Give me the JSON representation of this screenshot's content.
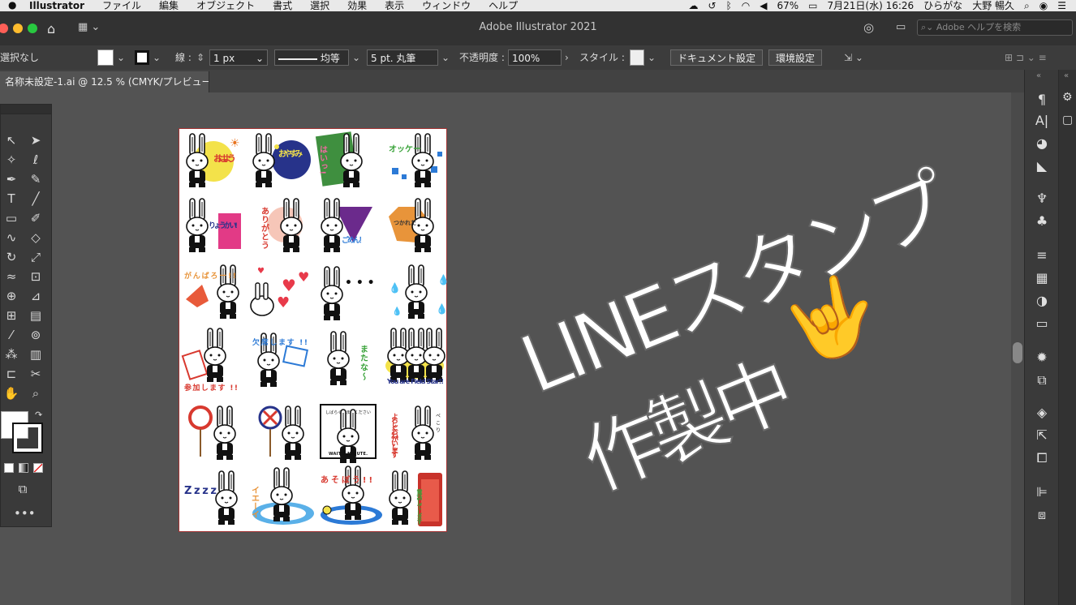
{
  "menubar": {
    "app": "Illustrator",
    "items": [
      "ファイル",
      "編集",
      "オブジェクト",
      "書式",
      "選択",
      "効果",
      "表示",
      "ウィンドウ",
      "ヘルプ"
    ],
    "battery": "67%",
    "datetime": "7月21日(水)  16:26",
    "input_mode": "ひらがな",
    "user": "大野 暢久"
  },
  "window": {
    "title": "Adobe Illustrator 2021",
    "search_placeholder": "Adobe ヘルプを検索"
  },
  "control": {
    "selection": "選択なし",
    "stroke_label": "線 :",
    "stroke_weight": "1 px",
    "stroke_profile": "均等",
    "brush": "5 pt. 丸筆",
    "opacity_label": "不透明度 :",
    "opacity": "100%",
    "style_label": "スタイル :",
    "doc_setup": "ドキュメント設定",
    "prefs": "環境設定"
  },
  "tab": {
    "name": "名称未設定-1.ai @ 12.5 % (CMYK/プレビュー)"
  },
  "stamps": {
    "s1": "おはよう",
    "s2": "おやすみ",
    "s3": "はいっ!",
    "s4": "オッケー",
    "s5": "りょうかい!",
    "s6": "ありがとう",
    "s7": "ごめん！",
    "s8": "つかれた",
    "s9": "がんばろー!!",
    "s11": "• • •",
    "s14": "欠席します !!",
    "s13": "参加します !!",
    "s15": "またな～",
    "s16": "You are Field Star!!",
    "s19a": "しばらくおまちください",
    "s19b": "WAIT A MINUTE.",
    "s20": "よろしくおねがいします",
    "s20b": "ぺこり",
    "s21": "Zzzz",
    "s22": "イエーイ",
    "s23": "あそぼう!!",
    "s24": "電話してします"
  },
  "overlay": {
    "line1": "LINEスタンプ",
    "line2": "作製中",
    "emoji": "🤟"
  },
  "colors": {
    "accent": "#a33333",
    "sticker_yellow": "#f3e24a",
    "sticker_navy": "#27338a"
  }
}
